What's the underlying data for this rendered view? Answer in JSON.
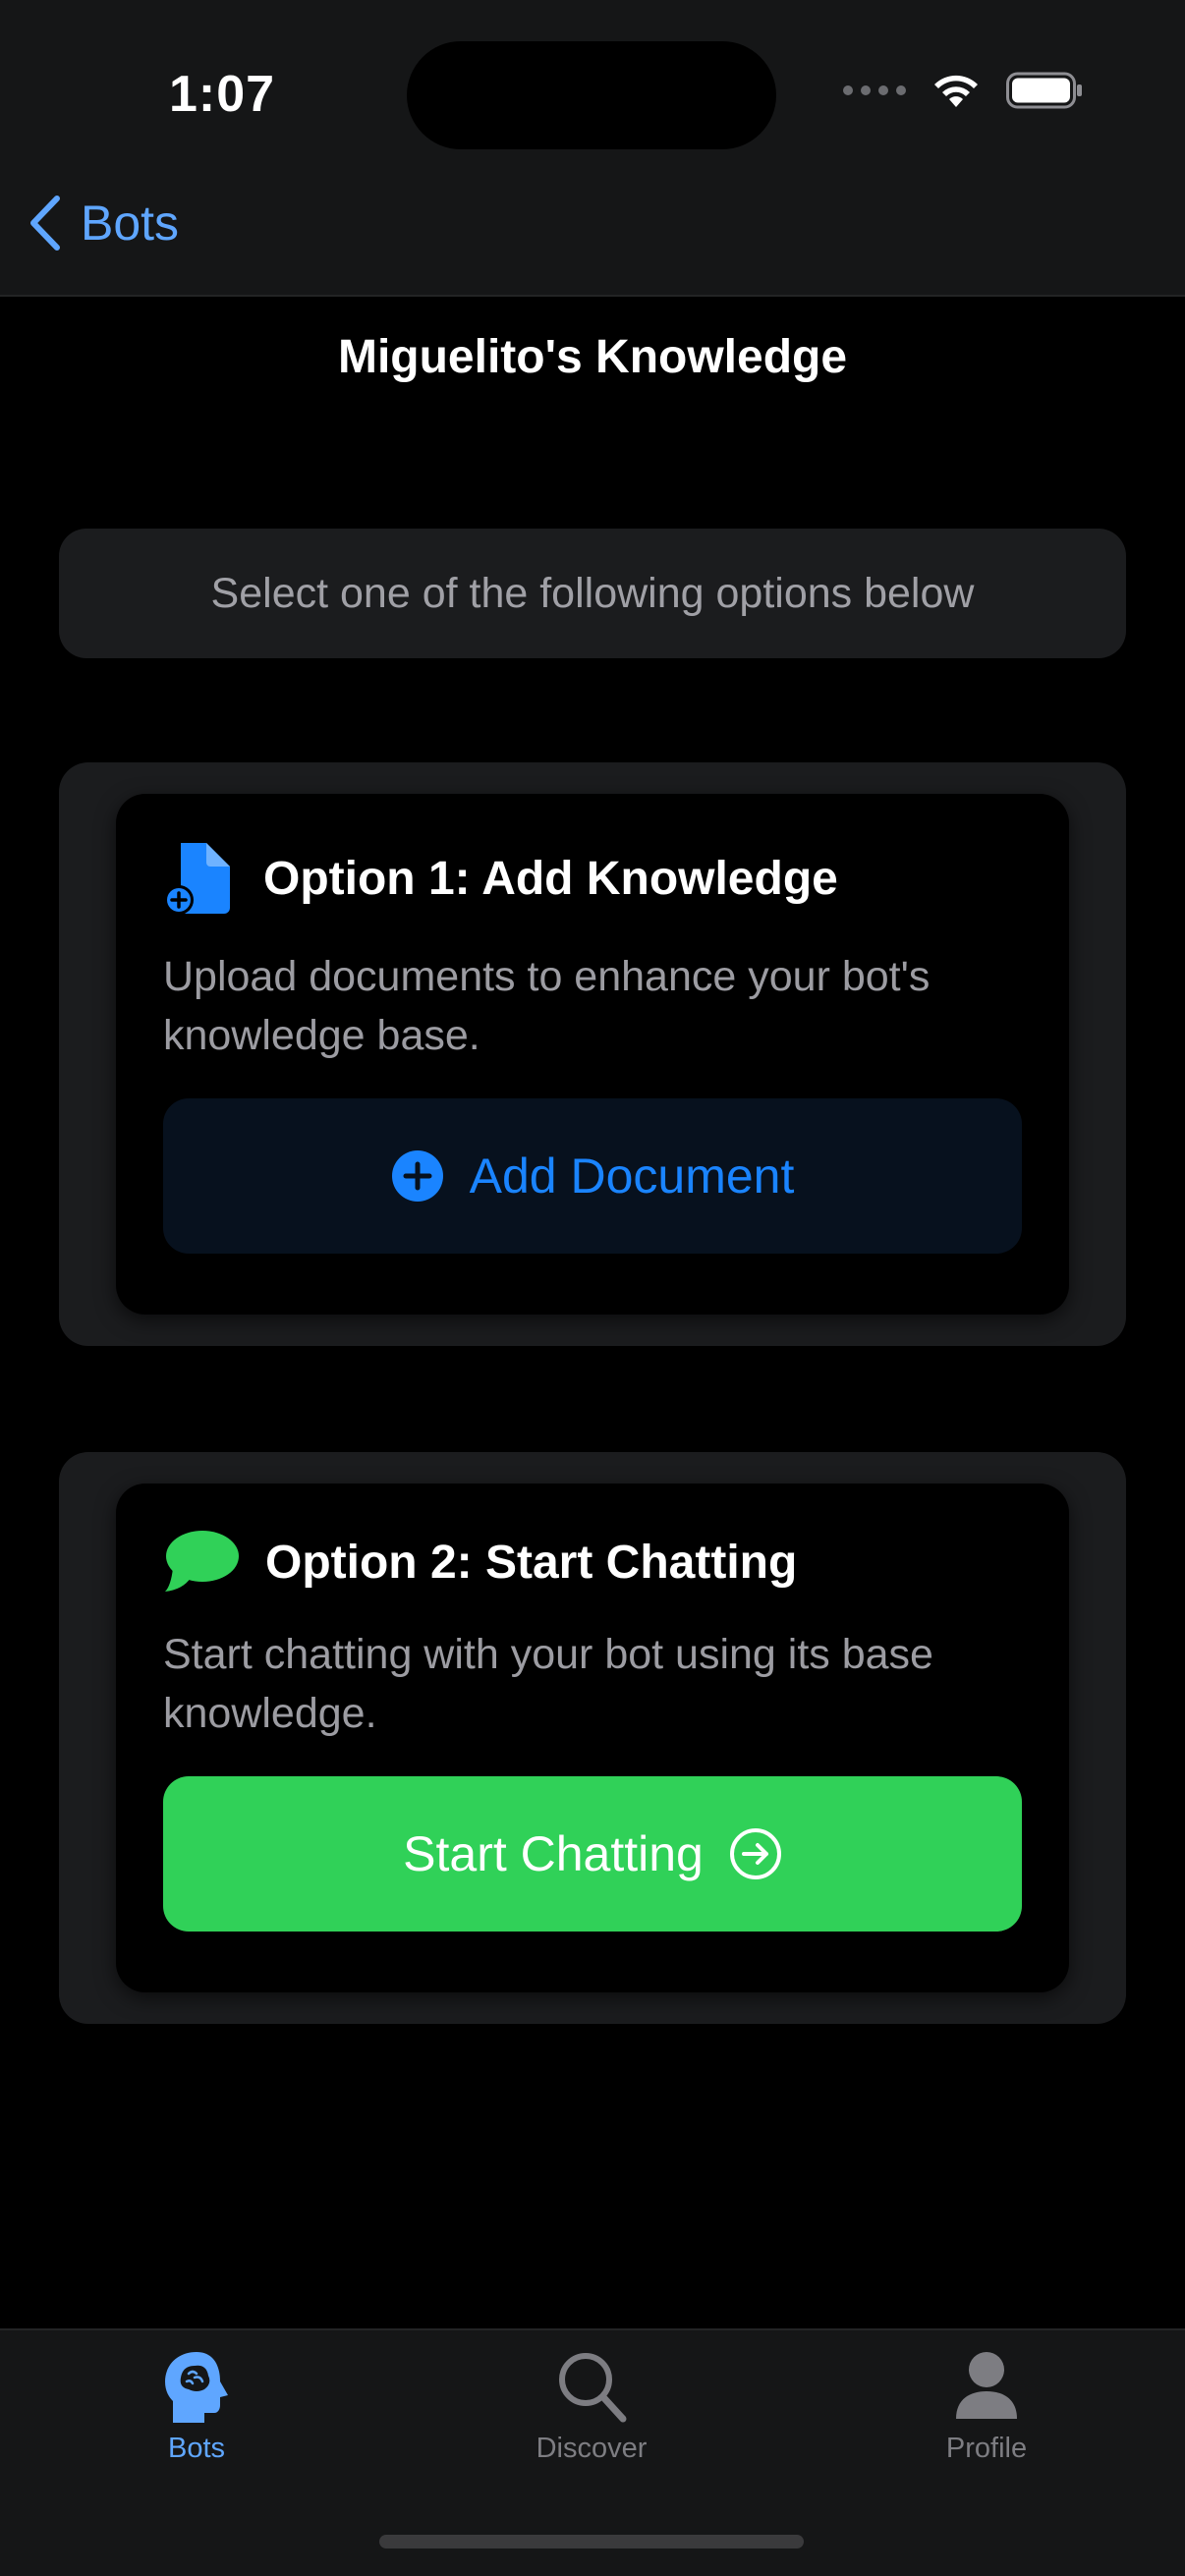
{
  "status_bar": {
    "time": "1:07",
    "icons": [
      "signal-dots-icon",
      "wifi-icon",
      "battery-icon"
    ]
  },
  "nav": {
    "back_label": "Bots",
    "title": "Miguelito's Knowledge"
  },
  "hint": {
    "text": "Select one of the following options below"
  },
  "option1": {
    "icon": "document-add-icon",
    "title": "Option 1: Add Knowledge",
    "description": "Upload documents to enhance your bot's knowledge base.",
    "button_label": "Add Document",
    "button_icon": "plus-circle-icon"
  },
  "option2": {
    "icon": "chat-bubble-icon",
    "title": "Option 2: Start Chatting",
    "description": "Start chatting with your bot using its base knowledge.",
    "button_label": "Start Chatting",
    "button_icon": "arrow-right-circle-icon"
  },
  "tabs": [
    {
      "label": "Bots",
      "icon": "brain-head-icon",
      "active": true
    },
    {
      "label": "Discover",
      "icon": "magnifier-icon",
      "active": false
    },
    {
      "label": "Profile",
      "icon": "person-icon",
      "active": false
    }
  ],
  "colors": {
    "accent_blue": "#1a84ff",
    "accent_green": "#30d158",
    "tab_active": "#5fa6ff"
  }
}
